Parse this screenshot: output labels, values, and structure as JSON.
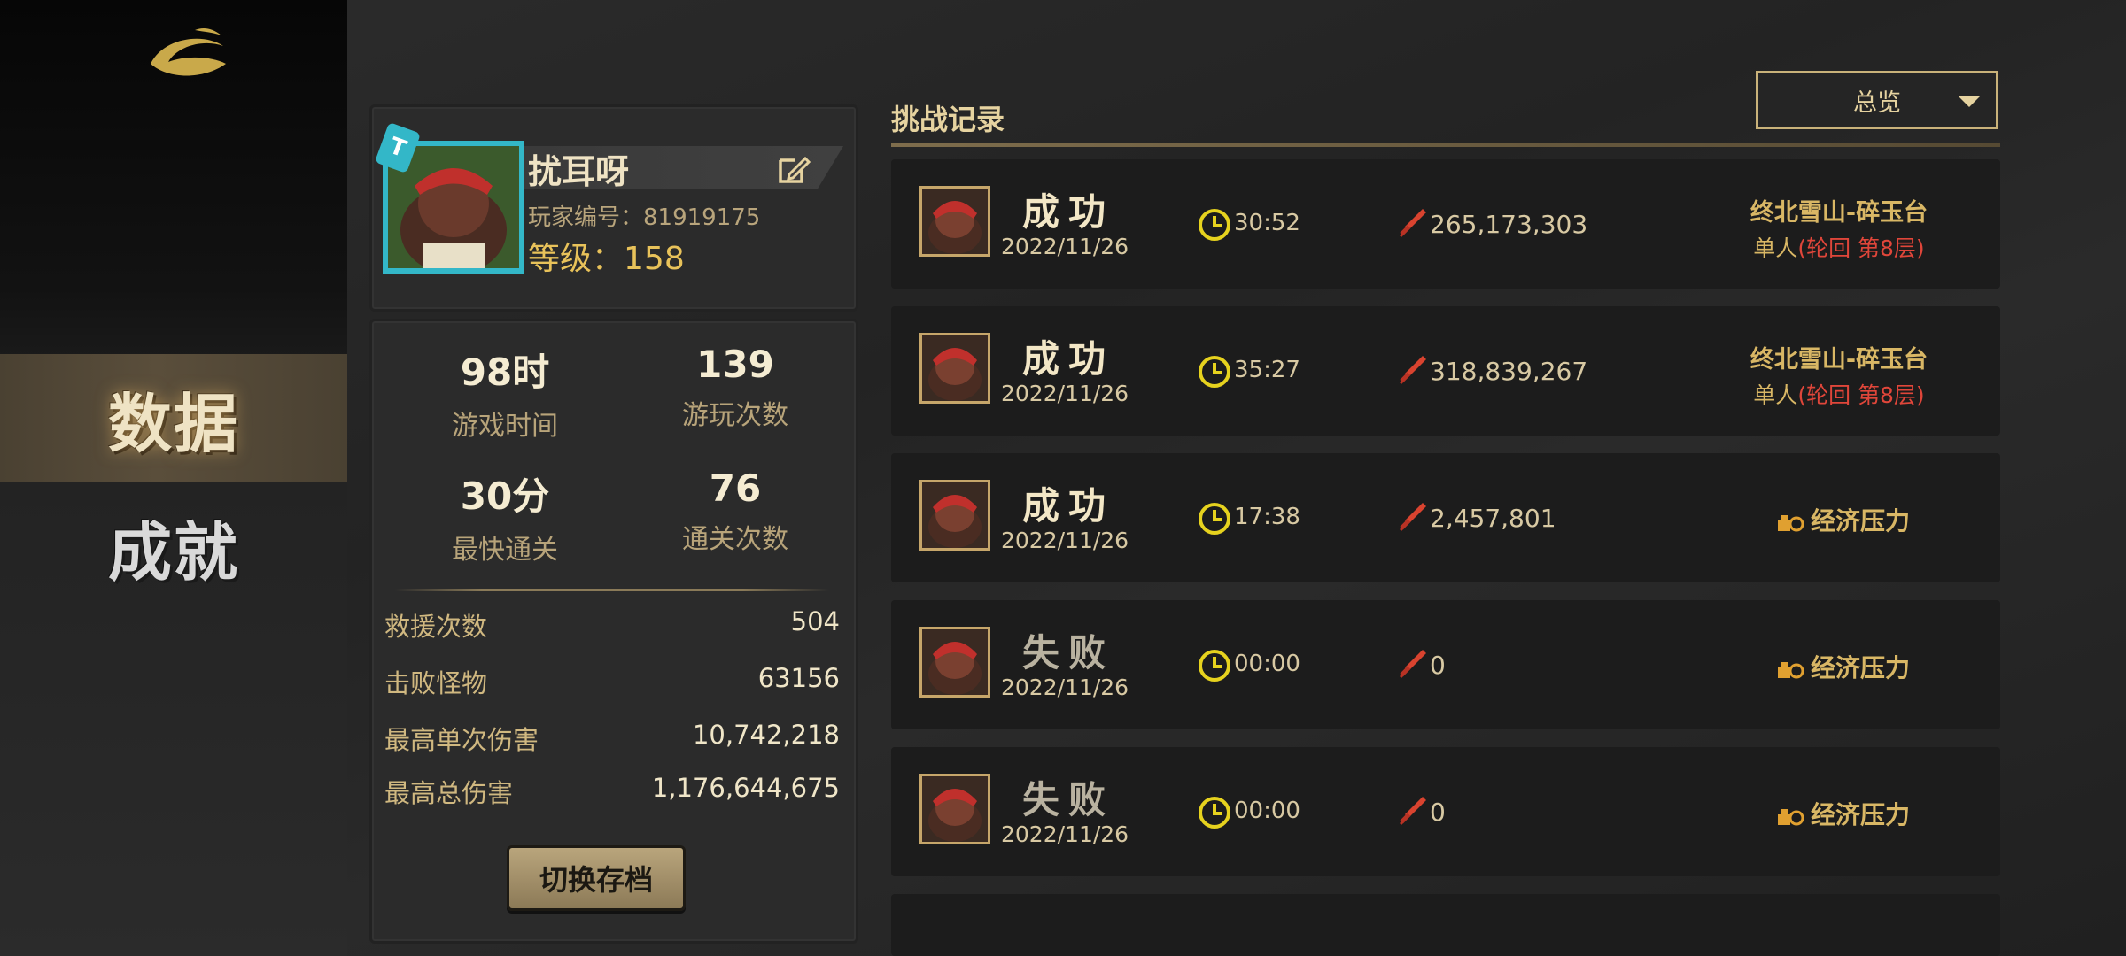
{
  "sidebar": {
    "nav": [
      {
        "label": "数据",
        "active": true
      },
      {
        "label": "成就",
        "active": false
      }
    ]
  },
  "profile": {
    "tag": "T",
    "name": "扰耳呀",
    "id_text": "玩家编号：81919175",
    "level_text": "等级：",
    "level_value": "158"
  },
  "stats": {
    "play_time_value": "98时",
    "play_time_label": "游戏时间",
    "play_count_value": "139",
    "play_count_label": "游玩次数",
    "fastest_value": "30分",
    "fastest_label": "最快通关",
    "clear_count_value": "76",
    "clear_count_label": "通关次数",
    "rows": [
      {
        "label": "救援次数",
        "value": "504"
      },
      {
        "label": "击败怪物",
        "value": "63156"
      },
      {
        "label": "最高单次伤害",
        "value": "10,742,218"
      },
      {
        "label": "最高总伤害",
        "value": "1,176,644,675"
      }
    ],
    "switch_button": "切换存档"
  },
  "records": {
    "title": "挑战记录",
    "filter": "总览",
    "items": [
      {
        "result": "成功",
        "status": "success",
        "date": "2022/11/26",
        "time": "30:52",
        "damage": "265,173,303",
        "location": "终北雪山-碎玉台",
        "detail_prefix": "单人",
        "detail_red": "(轮回  第8层)",
        "mode": ""
      },
      {
        "result": "成功",
        "status": "success",
        "date": "2022/11/26",
        "time": "35:27",
        "damage": "318,839,267",
        "location": "终北雪山-碎玉台",
        "detail_prefix": "单人",
        "detail_red": "(轮回  第8层)",
        "mode": ""
      },
      {
        "result": "成功",
        "status": "success",
        "date": "2022/11/26",
        "time": "17:38",
        "damage": "2,457,801",
        "location": "",
        "detail_prefix": "",
        "detail_red": "",
        "mode": "经济压力"
      },
      {
        "result": "失败",
        "status": "fail",
        "date": "2022/11/26",
        "time": "00:00",
        "damage": "0",
        "location": "",
        "detail_prefix": "",
        "detail_red": "",
        "mode": "经济压力"
      },
      {
        "result": "失败",
        "status": "fail",
        "date": "2022/11/26",
        "time": "00:00",
        "damage": "0",
        "location": "",
        "detail_prefix": "",
        "detail_red": "",
        "mode": "经济压力"
      }
    ]
  },
  "colors": {
    "accent_gold": "#d9b765",
    "avatar_frame": "#33b7c8",
    "danger_red": "#e0463a",
    "clock_yellow": "#e6d21e"
  }
}
